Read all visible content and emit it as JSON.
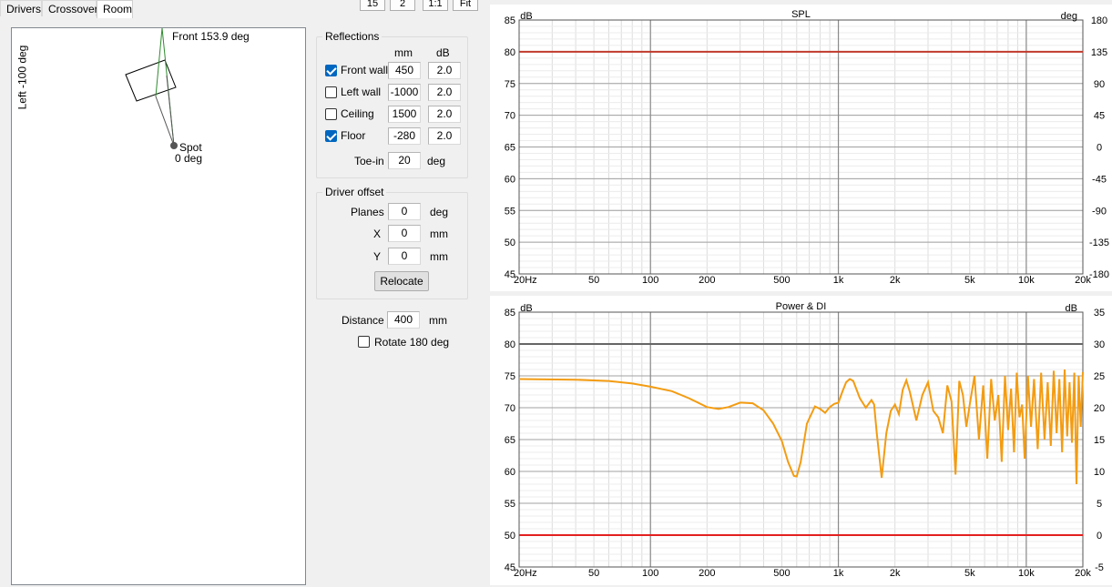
{
  "tabs": [
    {
      "label": "Drivers",
      "active": false
    },
    {
      "label": "Crossover",
      "active": false
    },
    {
      "label": "Room",
      "active": true
    }
  ],
  "toolbar": {
    "b1": "15",
    "b2": "2",
    "b3": "1:1",
    "b4": "Fit"
  },
  "room": {
    "front_label": "Front 153.9 deg",
    "left_label": "Left -100 deg",
    "spot_label": "Spot",
    "spot_angle": "0 deg"
  },
  "reflections": {
    "title": "Reflections",
    "col_mm": "mm",
    "col_db": "dB",
    "rows": [
      {
        "label": "Front wall",
        "checked": true,
        "mm": "450",
        "db": "2.0"
      },
      {
        "label": "Left wall",
        "checked": false,
        "mm": "-1000",
        "db": "2.0"
      },
      {
        "label": "Ceiling",
        "checked": false,
        "mm": "1500",
        "db": "2.0"
      },
      {
        "label": "Floor",
        "checked": true,
        "mm": "-280",
        "db": "2.0"
      }
    ],
    "toein_label": "Toe-in",
    "toein_value": "20",
    "toein_unit": "deg"
  },
  "driver_offset": {
    "title": "Driver offset",
    "planes_label": "Planes",
    "planes_value": "0",
    "planes_unit": "deg",
    "x_label": "X",
    "x_value": "0",
    "x_unit": "mm",
    "y_label": "Y",
    "y_value": "0",
    "y_unit": "mm",
    "relocate_label": "Relocate"
  },
  "distance": {
    "label": "Distance",
    "value": "400",
    "unit": "mm"
  },
  "rotate": {
    "label": "Rotate 180 deg",
    "checked": false
  },
  "chart_data": [
    {
      "type": "line",
      "title": "SPL",
      "ylabel_left": "dB",
      "ylabel_right": "deg",
      "xscale": "log",
      "xlim": [
        20,
        20000
      ],
      "ylim": [
        45,
        85
      ],
      "y2lim": [
        -180,
        180
      ],
      "x_ticks": [
        "20Hz",
        "50",
        "100",
        "200",
        "500",
        "1k",
        "2k",
        "5k",
        "10k",
        "20k"
      ],
      "y_ticks": [
        "85",
        "80",
        "75",
        "70",
        "65",
        "60",
        "55",
        "50",
        "45"
      ],
      "y2_ticks": [
        "180",
        "135",
        "90",
        "45",
        "0",
        "-45",
        "-90",
        "-135",
        "-180"
      ],
      "grid": true,
      "series": [
        {
          "color": "#c0392b",
          "x": [
            20,
            20000
          ],
          "y": [
            80,
            80
          ]
        }
      ]
    },
    {
      "type": "line",
      "title": "Power & DI",
      "ylabel_left": "dB",
      "ylabel_right": "dB",
      "xscale": "log",
      "xlim": [
        20,
        20000
      ],
      "ylim": [
        45,
        85
      ],
      "y2lim": [
        -5,
        35
      ],
      "x_ticks": [
        "20Hz",
        "50",
        "100",
        "200",
        "500",
        "1k",
        "2k",
        "5k",
        "10k",
        "20k"
      ],
      "y_ticks": [
        "85",
        "80",
        "75",
        "70",
        "65",
        "60",
        "55",
        "50",
        "45"
      ],
      "y2_ticks": [
        "35",
        "30",
        "25",
        "20",
        "15",
        "10",
        "5",
        "0",
        "-5"
      ],
      "grid": true,
      "series": [
        {
          "color": "#666666",
          "x": [
            20,
            20000
          ],
          "y": [
            80,
            80
          ]
        },
        {
          "color": "#e32020",
          "x": [
            20,
            20000
          ],
          "y": [
            50,
            50
          ]
        },
        {
          "color": "#f39c12",
          "x": [
            20,
            40,
            60,
            80,
            100,
            130,
            160,
            200,
            230,
            260,
            300,
            350,
            400,
            450,
            500,
            540,
            580,
            600,
            630,
            680,
            750,
            800,
            850,
            900,
            950,
            1000,
            1050,
            1100,
            1150,
            1200,
            1300,
            1400,
            1500,
            1550,
            1600,
            1700,
            1800,
            1900,
            2000,
            2100,
            2200,
            2300,
            2400,
            2600,
            2800,
            3000,
            3200,
            3400,
            3600,
            3800,
            4000,
            4200,
            4400,
            4600,
            4800,
            5000,
            5300,
            5600,
            5900,
            6200,
            6500,
            6800,
            7100,
            7400,
            7700,
            8000,
            8300,
            8600,
            8900,
            9200,
            9500,
            9800,
            10200,
            10600,
            11000,
            11500,
            12000,
            12500,
            13000,
            13500,
            14000,
            14500,
            15000,
            15500,
            16000,
            16500,
            17000,
            17500,
            18000,
            18500,
            19000,
            19500,
            20000
          ],
          "y": [
            74.5,
            74.4,
            74.2,
            73.8,
            73.3,
            72.6,
            71.5,
            70.1,
            69.8,
            70.1,
            70.8,
            70.7,
            69.6,
            67.5,
            64.8,
            61.5,
            59.3,
            59.2,
            61.5,
            67.5,
            70.2,
            69.8,
            69.2,
            70.1,
            70.6,
            70.8,
            72.5,
            74.0,
            74.5,
            74.2,
            71.5,
            70.0,
            71.2,
            70.5,
            66.0,
            59.0,
            66.0,
            69.5,
            70.5,
            69.0,
            72.8,
            74.3,
            72.5,
            68.0,
            72.0,
            74.0,
            69.5,
            68.5,
            66.0,
            73.5,
            71.0,
            59.5,
            74.2,
            72.0,
            67.0,
            70.5,
            75.0,
            65.0,
            73.5,
            62.0,
            74.5,
            68.0,
            72.0,
            61.5,
            75.0,
            66.5,
            73.0,
            63.0,
            75.5,
            68.5,
            70.5,
            62.0,
            75.0,
            67.0,
            74.5,
            63.5,
            75.5,
            65.0,
            74.0,
            64.0,
            75.8,
            66.0,
            74.5,
            63.0,
            76.0,
            65.5,
            74.0,
            64.5,
            75.5,
            58.0,
            75.0,
            67.0,
            75.6
          ]
        }
      ]
    }
  ]
}
